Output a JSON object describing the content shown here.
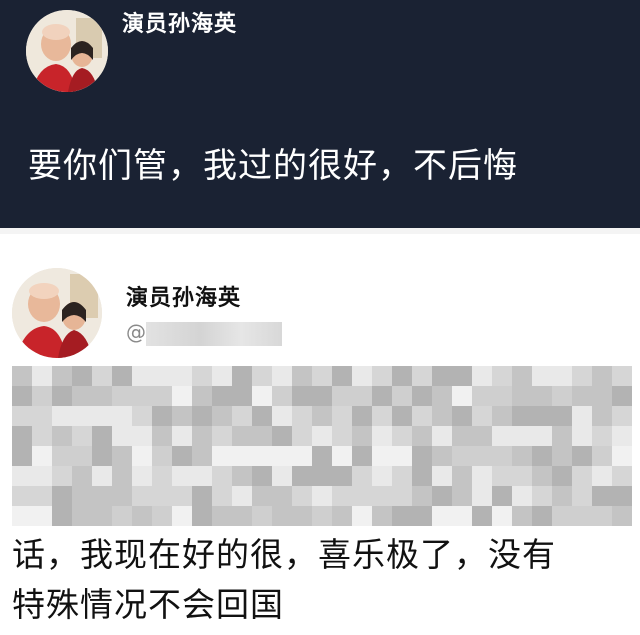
{
  "top_post": {
    "author": "演员孙海英",
    "text": "要你们管，我过的很好，不后悔"
  },
  "bottom_post": {
    "author": "演员孙海英",
    "handle_prefix": "@",
    "visible_lines": [
      "话，我现在好的很，喜乐极了，没有",
      "特殊情况不会回国"
    ]
  },
  "colors": {
    "dark_background": "#1a2233",
    "light_background": "#ffffff"
  }
}
